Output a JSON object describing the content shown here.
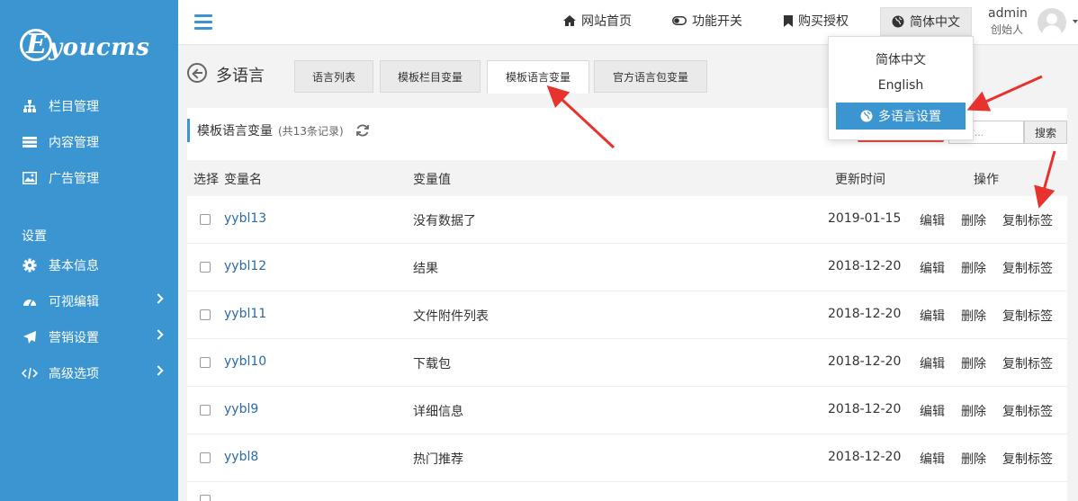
{
  "brand": {
    "logo_letter": "E",
    "logo_text": "youcms"
  },
  "sidebar": {
    "items": [
      {
        "label": "栏目管理",
        "icon": "sitemap-icon"
      },
      {
        "label": "内容管理",
        "icon": "list-icon"
      },
      {
        "label": "广告管理",
        "icon": "image-icon"
      }
    ],
    "section_label": "设置",
    "settings_items": [
      {
        "label": "基本信息",
        "icon": "gear-icon"
      },
      {
        "label": "可视编辑",
        "icon": "dashboard-icon"
      },
      {
        "label": "营销设置",
        "icon": "paper-plane-icon"
      },
      {
        "label": "高级选项",
        "icon": "code-icon"
      }
    ]
  },
  "topbar": {
    "links": [
      {
        "label": "网站首页",
        "icon": "home-icon"
      },
      {
        "label": "功能开关",
        "icon": "toggle-icon"
      },
      {
        "label": "购买授权",
        "icon": "bookmark-icon"
      }
    ],
    "language": "简体中文",
    "user_name": "admin",
    "user_role": "创始人"
  },
  "language_menu": {
    "options": [
      "简体中文",
      "English"
    ],
    "setting_button": "多语言设置"
  },
  "page": {
    "title": "多语言",
    "tabs": [
      "语言列表",
      "模板栏目变量",
      "模板语言变量",
      "官方语言包变量"
    ],
    "active_tab": 2
  },
  "panel": {
    "title": "模板语言变量",
    "count": "(共13条记录)",
    "search_placeholder": "搜索...",
    "search_button": "搜索"
  },
  "table": {
    "headers": {
      "select": "选择",
      "name": "变量名",
      "value": "变量值",
      "updated": "更新时间",
      "actions": "操作"
    },
    "action_labels": {
      "edit": "编辑",
      "delete": "删除",
      "copy": "复制标签"
    },
    "rows": [
      {
        "name": "yybl13",
        "value": "没有数据了",
        "date": "2019-01-15"
      },
      {
        "name": "yybl12",
        "value": "结果",
        "date": "2018-12-20"
      },
      {
        "name": "yybl11",
        "value": "文件附件列表",
        "date": "2018-12-20"
      },
      {
        "name": "yybl10",
        "value": "下载包",
        "date": "2018-12-20"
      },
      {
        "name": "yybl9",
        "value": "详细信息",
        "date": "2018-12-20"
      },
      {
        "name": "yybl8",
        "value": "热门推荐",
        "date": "2018-12-20"
      }
    ]
  },
  "colors": {
    "sidebar": "#3a95d0",
    "link": "#2a6aa5",
    "annotation_arrow": "#e8322d"
  }
}
